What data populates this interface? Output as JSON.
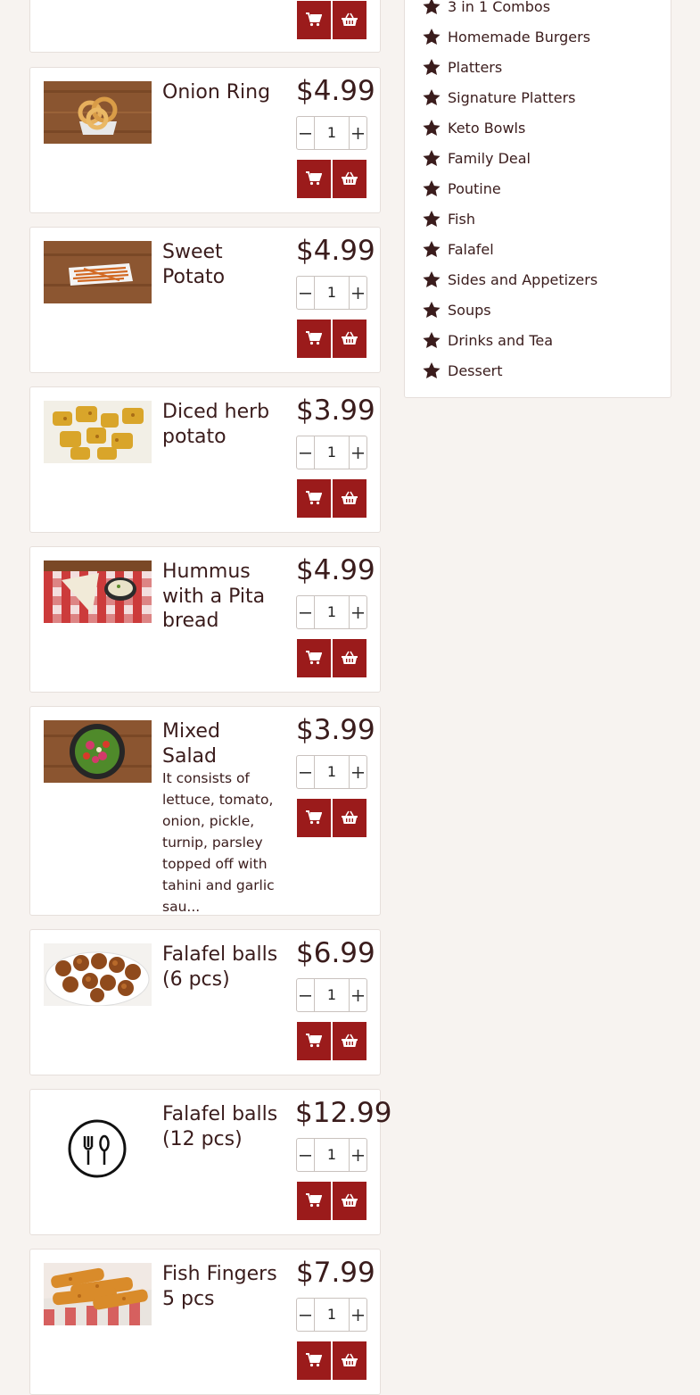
{
  "currency_note": "",
  "colors": {
    "accent": "#9b1b1b",
    "text": "#3a1c1c",
    "background": "#f7f3f0"
  },
  "items": [
    {
      "name": "",
      "price": "",
      "qty": "",
      "visible_partial": true
    },
    {
      "name": "Onion Ring",
      "price": "$4.99",
      "qty": "1",
      "image": "onion-ring-photo"
    },
    {
      "name": "Sweet Potato",
      "price": "$4.99",
      "qty": "1",
      "image": "sweet-potato-fries-photo"
    },
    {
      "name": "Diced herb potato",
      "price": "$3.99",
      "qty": "1",
      "image": "diced-potato-photo"
    },
    {
      "name": "Hummus with a Pita bread",
      "price": "$4.99",
      "qty": "1",
      "image": "hummus-photo"
    },
    {
      "name": "Mixed Salad",
      "price": "$3.99",
      "qty": "1",
      "image": "salad-photo",
      "description": "It consists of lettuce, tomato, onion, pickle, turnip, parsley topped off with tahini and garlic sau..."
    },
    {
      "name": "Falafel balls (6 pcs)",
      "price": "$6.99",
      "qty": "1",
      "image": "falafel-photo"
    },
    {
      "name": "Falafel balls (12 pcs)",
      "price": "$12.99",
      "qty": "1",
      "image": "placeholder-utensils-icon"
    },
    {
      "name": "Fish Fingers 5 pcs",
      "price": "$7.99",
      "qty": "1",
      "image": "fish-fingers-photo"
    }
  ],
  "categories": [
    "3 in 1 Combos",
    "Homemade Burgers",
    "Platters",
    "Signature Platters",
    "Keto Bowls",
    "Family Deal",
    "Poutine",
    "Fish",
    "Falafel",
    "Sides and Appetizers",
    "Soups",
    "Drinks and Tea",
    "Dessert"
  ],
  "icons": {
    "add_to_cart": "cart-icon",
    "buy_now": "basket-icon",
    "decrement": "minus-icon",
    "increment": "plus-icon",
    "category": "star-icon"
  }
}
